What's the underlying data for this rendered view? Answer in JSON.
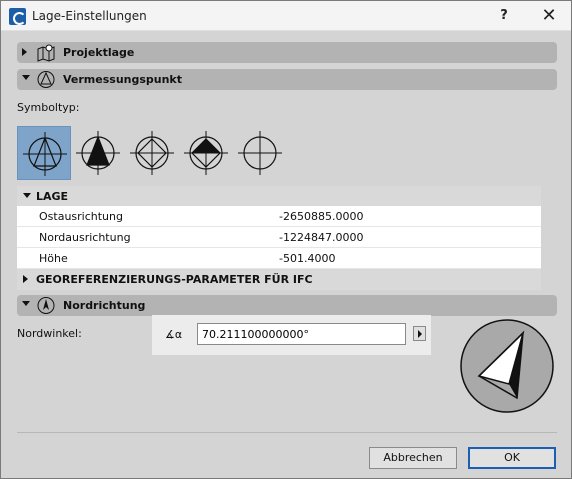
{
  "window": {
    "title": "Lage-Einstellungen",
    "help_label": "?",
    "close_label": "✕"
  },
  "sections": {
    "projektlage": "Projektlage",
    "vermessungspunkt": "Vermessungspunkt",
    "nordrichtung": "Nordrichtung"
  },
  "symboltyp": {
    "label": "Symboltyp:",
    "selected_index": 0,
    "symbols": [
      "symbol-triangle-outline",
      "symbol-triangle-filled",
      "symbol-diamond-half",
      "symbol-diamond-quarter",
      "symbol-cross-circle"
    ]
  },
  "lage": {
    "header": "LAGE",
    "rows": [
      {
        "label": "Ostausrichtung",
        "value": "-2650885.0000"
      },
      {
        "label": "Nordausrichtung",
        "value": "-1224847.0000"
      },
      {
        "label": "Höhe",
        "value": "-501.4000"
      }
    ],
    "ifc_header": "GEOREFERENZIERUNGS-PARAMETER FÜR IFC"
  },
  "nordwinkel": {
    "label": "Nordwinkel:",
    "angle_symbol": "∡α",
    "value": "70.211100000000°"
  },
  "buttons": {
    "cancel": "Abbrechen",
    "ok": "OK"
  },
  "colors": {
    "selected_symbol": "#7ea4ca",
    "ok_border": "#1a5fb4",
    "section_bar": "#b3b3b3"
  }
}
